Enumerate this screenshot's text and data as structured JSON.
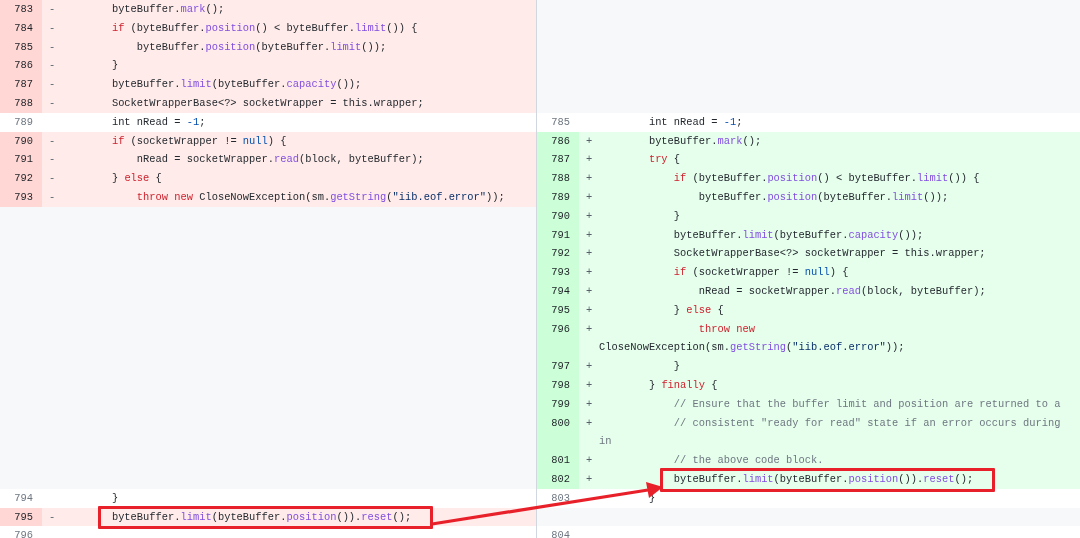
{
  "diff_rows": [
    {
      "left": {
        "kind": "del",
        "num": "783",
        "sign": "-",
        "highlighted": false,
        "code": [
          {
            "kind": "plain",
            "text": "        byteBuffer."
          },
          {
            "kind": "method",
            "text": "mark"
          },
          {
            "kind": "plain",
            "text": "();"
          }
        ]
      },
      "right": {
        "kind": "empty"
      }
    },
    {
      "left": {
        "kind": "del",
        "num": "784",
        "sign": "-",
        "highlighted": false,
        "code": [
          {
            "kind": "keyword",
            "text": "        if"
          },
          {
            "kind": "plain",
            "text": " (byteBuffer."
          },
          {
            "kind": "method",
            "text": "position"
          },
          {
            "kind": "plain",
            "text": "() < byteBuffer."
          },
          {
            "kind": "method",
            "text": "limit"
          },
          {
            "kind": "plain",
            "text": "()) {"
          }
        ]
      },
      "right": {
        "kind": "empty"
      }
    },
    {
      "left": {
        "kind": "del",
        "num": "785",
        "sign": "-",
        "highlighted": false,
        "code": [
          {
            "kind": "plain",
            "text": "            byteBuffer."
          },
          {
            "kind": "method",
            "text": "position"
          },
          {
            "kind": "plain",
            "text": "(byteBuffer."
          },
          {
            "kind": "method",
            "text": "limit"
          },
          {
            "kind": "plain",
            "text": "());"
          }
        ]
      },
      "right": {
        "kind": "empty"
      }
    },
    {
      "left": {
        "kind": "del",
        "num": "786",
        "sign": "-",
        "highlighted": false,
        "code": [
          {
            "kind": "plain",
            "text": "        }"
          }
        ]
      },
      "right": {
        "kind": "empty"
      }
    },
    {
      "left": {
        "kind": "del",
        "num": "787",
        "sign": "-",
        "highlighted": false,
        "code": [
          {
            "kind": "plain",
            "text": "        byteBuffer."
          },
          {
            "kind": "method",
            "text": "limit"
          },
          {
            "kind": "plain",
            "text": "(byteBuffer."
          },
          {
            "kind": "method",
            "text": "capacity"
          },
          {
            "kind": "plain",
            "text": "());"
          }
        ]
      },
      "right": {
        "kind": "empty"
      }
    },
    {
      "left": {
        "kind": "del",
        "num": "788",
        "sign": "-",
        "highlighted": false,
        "code": [
          {
            "kind": "plain",
            "text": "        SocketWrapperBase<?> socketWrapper = this.wrapper;"
          }
        ]
      },
      "right": {
        "kind": "empty"
      }
    },
    {
      "left": {
        "kind": "ctx",
        "num": "789",
        "highlighted": false,
        "code": [
          {
            "kind": "plain",
            "text": "        int nRead = "
          },
          {
            "kind": "constant",
            "text": "-1"
          },
          {
            "kind": "plain",
            "text": ";"
          }
        ]
      },
      "right": {
        "kind": "ctx",
        "num": "785",
        "highlighted": false,
        "code": [
          {
            "kind": "plain",
            "text": "        int nRead = "
          },
          {
            "kind": "constant",
            "text": "-1"
          },
          {
            "kind": "plain",
            "text": ";"
          }
        ]
      }
    },
    {
      "left": {
        "kind": "del",
        "num": "790",
        "sign": "-",
        "highlighted": false,
        "code": [
          {
            "kind": "keyword",
            "text": "        if"
          },
          {
            "kind": "plain",
            "text": " (socketWrapper != "
          },
          {
            "kind": "constant",
            "text": "null"
          },
          {
            "kind": "plain",
            "text": ") {"
          }
        ]
      },
      "right": {
        "kind": "add",
        "num": "786",
        "sign": "+",
        "highlighted": false,
        "code": [
          {
            "kind": "plain",
            "text": "        byteBuffer."
          },
          {
            "kind": "method",
            "text": "mark"
          },
          {
            "kind": "plain",
            "text": "();"
          }
        ]
      }
    },
    {
      "left": {
        "kind": "del",
        "num": "791",
        "sign": "-",
        "highlighted": false,
        "code": [
          {
            "kind": "plain",
            "text": "            nRead = socketWrapper."
          },
          {
            "kind": "method",
            "text": "read"
          },
          {
            "kind": "plain",
            "text": "(block, byteBuffer);"
          }
        ]
      },
      "right": {
        "kind": "add",
        "num": "787",
        "sign": "+",
        "highlighted": false,
        "code": [
          {
            "kind": "keyword",
            "text": "        try"
          },
          {
            "kind": "plain",
            "text": " {"
          }
        ]
      }
    },
    {
      "left": {
        "kind": "del",
        "num": "792",
        "sign": "-",
        "highlighted": false,
        "code": [
          {
            "kind": "plain",
            "text": "        } "
          },
          {
            "kind": "keyword",
            "text": "else"
          },
          {
            "kind": "plain",
            "text": " {"
          }
        ]
      },
      "right": {
        "kind": "add",
        "num": "788",
        "sign": "+",
        "highlighted": false,
        "code": [
          {
            "kind": "keyword",
            "text": "            if"
          },
          {
            "kind": "plain",
            "text": " (byteBuffer."
          },
          {
            "kind": "method",
            "text": "position"
          },
          {
            "kind": "plain",
            "text": "() < byteBuffer."
          },
          {
            "kind": "method",
            "text": "limit"
          },
          {
            "kind": "plain",
            "text": "()) {"
          }
        ]
      }
    },
    {
      "left": {
        "kind": "del",
        "num": "793",
        "sign": "-",
        "highlighted": false,
        "code": [
          {
            "kind": "keyword",
            "text": "            throw new"
          },
          {
            "kind": "plain",
            "text": " CloseNowException(sm."
          },
          {
            "kind": "method",
            "text": "getString"
          },
          {
            "kind": "plain",
            "text": "("
          },
          {
            "kind": "string",
            "text": "\"iib.eof.error\""
          },
          {
            "kind": "plain",
            "text": "));"
          }
        ]
      },
      "right": {
        "kind": "add",
        "num": "789",
        "sign": "+",
        "highlighted": false,
        "code": [
          {
            "kind": "plain",
            "text": "                byteBuffer."
          },
          {
            "kind": "method",
            "text": "position"
          },
          {
            "kind": "plain",
            "text": "(byteBuffer."
          },
          {
            "kind": "method",
            "text": "limit"
          },
          {
            "kind": "plain",
            "text": "());"
          }
        ]
      }
    },
    {
      "left": {
        "kind": "empty"
      },
      "right": {
        "kind": "add",
        "num": "790",
        "sign": "+",
        "highlighted": false,
        "code": [
          {
            "kind": "plain",
            "text": "            }"
          }
        ]
      }
    },
    {
      "left": {
        "kind": "empty"
      },
      "right": {
        "kind": "add",
        "num": "791",
        "sign": "+",
        "highlighted": false,
        "code": [
          {
            "kind": "plain",
            "text": "            byteBuffer."
          },
          {
            "kind": "method",
            "text": "limit"
          },
          {
            "kind": "plain",
            "text": "(byteBuffer."
          },
          {
            "kind": "method",
            "text": "capacity"
          },
          {
            "kind": "plain",
            "text": "());"
          }
        ]
      }
    },
    {
      "left": {
        "kind": "empty"
      },
      "right": {
        "kind": "add",
        "num": "792",
        "sign": "+",
        "highlighted": false,
        "code": [
          {
            "kind": "plain",
            "text": "            SocketWrapperBase<?> socketWrapper = this.wrapper;"
          }
        ]
      }
    },
    {
      "left": {
        "kind": "empty"
      },
      "right": {
        "kind": "add",
        "num": "793",
        "sign": "+",
        "highlighted": false,
        "code": [
          {
            "kind": "keyword",
            "text": "            if"
          },
          {
            "kind": "plain",
            "text": " (socketWrapper != "
          },
          {
            "kind": "constant",
            "text": "null"
          },
          {
            "kind": "plain",
            "text": ") {"
          }
        ]
      }
    },
    {
      "left": {
        "kind": "empty"
      },
      "right": {
        "kind": "add",
        "num": "794",
        "sign": "+",
        "highlighted": false,
        "code": [
          {
            "kind": "plain",
            "text": "                nRead = socketWrapper."
          },
          {
            "kind": "method",
            "text": "read"
          },
          {
            "kind": "plain",
            "text": "(block, byteBuffer);"
          }
        ]
      }
    },
    {
      "left": {
        "kind": "empty"
      },
      "right": {
        "kind": "add",
        "num": "795",
        "sign": "+",
        "highlighted": false,
        "code": [
          {
            "kind": "plain",
            "text": "            } "
          },
          {
            "kind": "keyword",
            "text": "else"
          },
          {
            "kind": "plain",
            "text": " {"
          }
        ]
      }
    },
    {
      "left": {
        "kind": "empty"
      },
      "right": {
        "kind": "add",
        "num": "796",
        "sign": "+",
        "highlighted": false,
        "code": [
          {
            "kind": "keyword",
            "text": "                throw new"
          },
          {
            "kind": "plain",
            "text": " CloseNowException(sm."
          },
          {
            "kind": "method",
            "text": "getString"
          },
          {
            "kind": "plain",
            "text": "("
          },
          {
            "kind": "string",
            "text": "\"iib.eof.error\""
          },
          {
            "kind": "plain",
            "text": "));"
          }
        ]
      }
    },
    {
      "left": {
        "kind": "empty"
      },
      "right": {
        "kind": "add",
        "num": "797",
        "sign": "+",
        "highlighted": false,
        "code": [
          {
            "kind": "plain",
            "text": "            }"
          }
        ]
      }
    },
    {
      "left": {
        "kind": "empty"
      },
      "right": {
        "kind": "add",
        "num": "798",
        "sign": "+",
        "highlighted": false,
        "code": [
          {
            "kind": "plain",
            "text": "        } "
          },
          {
            "kind": "keyword",
            "text": "finally"
          },
          {
            "kind": "plain",
            "text": " {"
          }
        ]
      }
    },
    {
      "left": {
        "kind": "empty"
      },
      "right": {
        "kind": "add",
        "num": "799",
        "sign": "+",
        "highlighted": false,
        "code": [
          {
            "kind": "comment",
            "text": "            // Ensure that the buffer limit and position are returned to a"
          }
        ]
      }
    },
    {
      "left": {
        "kind": "empty"
      },
      "right": {
        "kind": "add",
        "num": "800",
        "sign": "+",
        "highlighted": false,
        "code": [
          {
            "kind": "comment",
            "text": "            // consistent \"ready for read\" state if an error occurs during in"
          }
        ]
      }
    },
    {
      "left": {
        "kind": "empty"
      },
      "right": {
        "kind": "add",
        "num": "801",
        "sign": "+",
        "highlighted": false,
        "code": [
          {
            "kind": "comment",
            "text": "            // the above code block."
          }
        ]
      }
    },
    {
      "left": {
        "kind": "empty"
      },
      "right": {
        "kind": "add",
        "num": "802",
        "sign": "+",
        "highlighted": true,
        "code": [
          {
            "kind": "plain",
            "text": "            byteBuffer."
          },
          {
            "kind": "method",
            "text": "limit"
          },
          {
            "kind": "plain",
            "text": "(byteBuffer."
          },
          {
            "kind": "method",
            "text": "position"
          },
          {
            "kind": "plain",
            "text": "())."
          },
          {
            "kind": "method",
            "text": "reset"
          },
          {
            "kind": "plain",
            "text": "();"
          }
        ]
      }
    },
    {
      "left": {
        "kind": "ctx",
        "num": "794",
        "highlighted": false,
        "code": [
          {
            "kind": "plain",
            "text": "        }"
          }
        ]
      },
      "right": {
        "kind": "ctx",
        "num": "803",
        "highlighted": false,
        "code": [
          {
            "kind": "plain",
            "text": "        }"
          }
        ]
      }
    },
    {
      "left": {
        "kind": "del",
        "num": "795",
        "sign": "-",
        "highlighted": true,
        "code": [
          {
            "kind": "plain",
            "text": "        byteBuffer."
          },
          {
            "kind": "method",
            "text": "limit"
          },
          {
            "kind": "plain",
            "text": "(byteBuffer."
          },
          {
            "kind": "method",
            "text": "position"
          },
          {
            "kind": "plain",
            "text": "())."
          },
          {
            "kind": "method",
            "text": "reset"
          },
          {
            "kind": "plain",
            "text": "();"
          }
        ]
      },
      "right": {
        "kind": "empty"
      }
    },
    {
      "left": {
        "kind": "ctx",
        "num": "796"
      },
      "right": {
        "kind": "ctx",
        "num": "804"
      }
    }
  ]
}
